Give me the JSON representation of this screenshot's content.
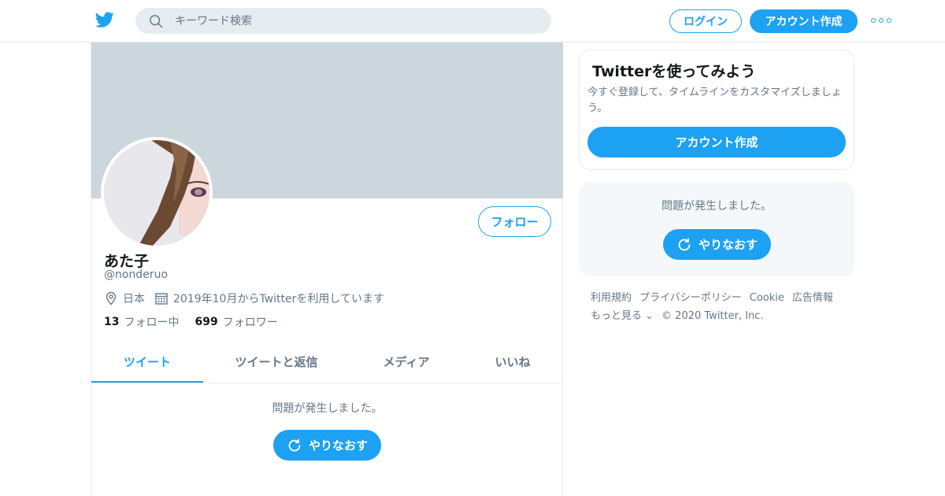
{
  "header": {
    "logo_icon": "twitter-bird-icon",
    "search_placeholder": "キーワード検索",
    "login_label": "ログイン",
    "signup_label": "アカウント作成",
    "more_icon": "more-dots-icon"
  },
  "profile": {
    "name": "あた子",
    "handle": "@nonderuo",
    "location": "日本",
    "joined": "2019年10月からTwitterを利用しています",
    "following_count": "13",
    "following_label": "フォロー中",
    "followers_count": "699",
    "followers_label": "フォロワー",
    "follow_button": "フォロー"
  },
  "tabs": [
    {
      "label": "ツイート",
      "active": true
    },
    {
      "label": "ツイートと返信",
      "active": false
    },
    {
      "label": "メディア",
      "active": false
    },
    {
      "label": "いいね",
      "active": false
    }
  ],
  "timeline": {
    "error_message": "問題が発生しました。",
    "retry_label": "やりなおす"
  },
  "sidebar": {
    "signup_title": "Twitterを使ってみよう",
    "signup_desc": "今すぐ登録して、タイムラインをカスタマイズしましょう。",
    "signup_button": "アカウント作成",
    "error_message": "問題が発生しました。",
    "retry_label": "やりなおす"
  },
  "footer": {
    "links": [
      "利用規約",
      "プライバシーポリシー",
      "Cookie",
      "広告情報"
    ],
    "more_label": "もっと見る",
    "copyright": "© 2020 Twitter, Inc."
  },
  "colors": {
    "accent": "#1da1f2",
    "banner": "#ccd6dd",
    "secondary_text": "#657786"
  }
}
